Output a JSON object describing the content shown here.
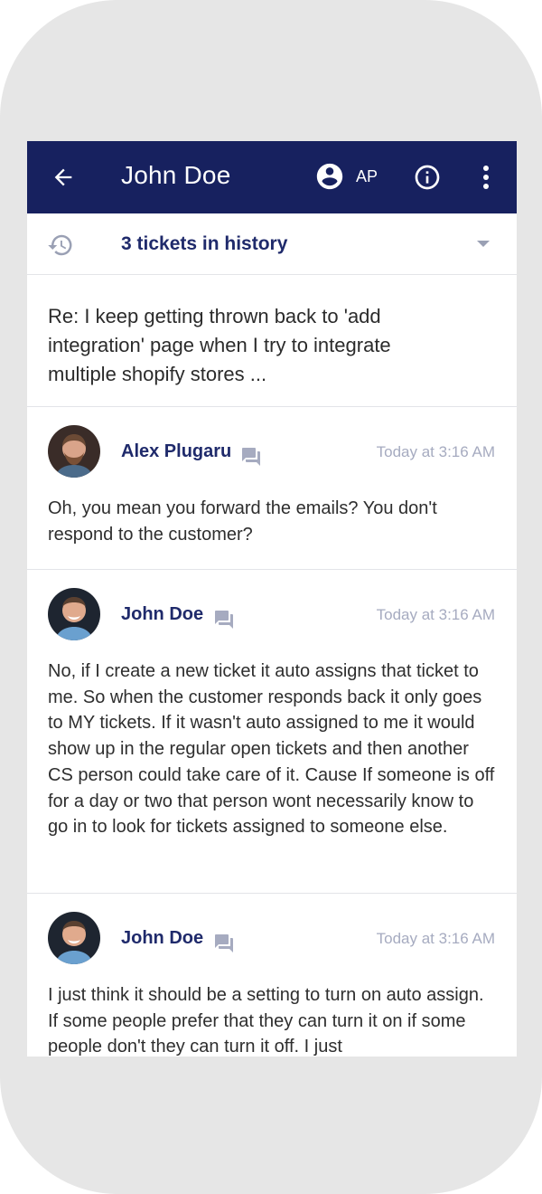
{
  "header": {
    "title": "John Doe",
    "assignee_initials": "AP",
    "icons": [
      "arrow-back-icon",
      "account-circle-icon",
      "info-icon",
      "more-vert-icon"
    ]
  },
  "history": {
    "label": "3 tickets in history",
    "icon": "history-icon"
  },
  "ticket": {
    "subject": "Re: I keep getting thrown back to 'add integration' page when I try to integrate multiple shopify stores ..."
  },
  "messages": [
    {
      "author": "Alex Plugaru",
      "time": "Today at 3:16 AM",
      "channel_icon": "chat-icon",
      "body": "Oh, you mean you forward the emails? You don't respond to the customer?"
    },
    {
      "author": "John Doe",
      "time": "Today at 3:16 AM",
      "channel_icon": "chat-icon",
      "body": "No, if I create a new ticket it auto assigns that ticket to me. So when the customer responds back it only goes to MY tickets. If it wasn't auto assigned to me it would show up in the regular open tickets and then another CS person could take care of it. Cause If someone is off for a day or two that person wont necessarily know to go in to look for tickets assigned to someone else."
    },
    {
      "author": "John Doe",
      "time": "Today at 3:16 AM",
      "channel_icon": "chat-icon",
      "body": "I just think it should be a setting to turn on auto assign. If some people prefer that they can turn it on if some people don't they can turn it off. I just"
    }
  ],
  "colors": {
    "appbar": "#17215f",
    "accent_text": "#1f2a6b",
    "muted": "#a6abc0",
    "frame": "#e6e6e6"
  }
}
